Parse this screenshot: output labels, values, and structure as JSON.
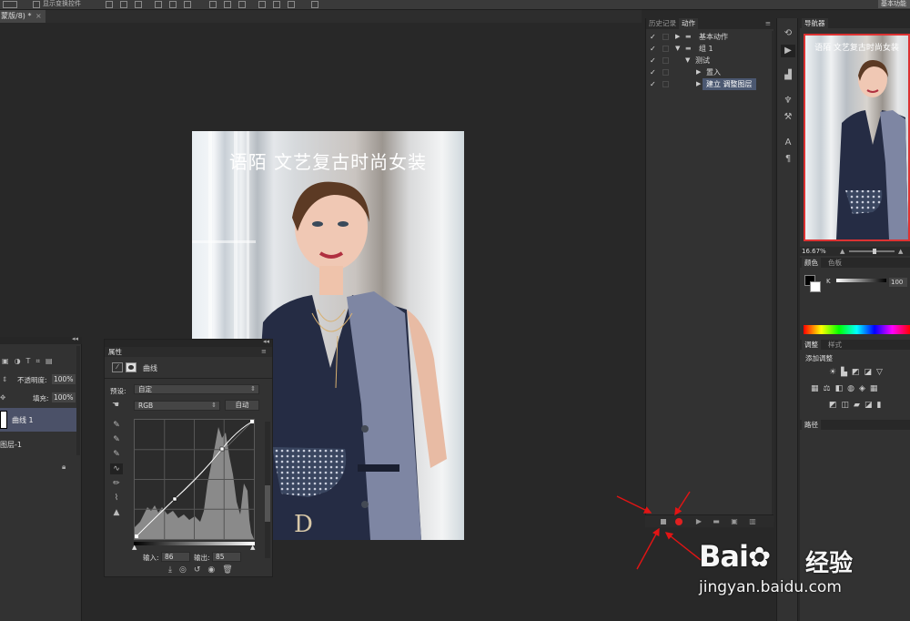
{
  "option_bar": {
    "show_transform_label": "显示变换控件",
    "workspace_label": "基本功能"
  },
  "document_tab": {
    "label": "蒙版/8) *",
    "close": "×"
  },
  "photo": {
    "caption": "语陌  文艺复古时尚女装"
  },
  "actions_panel": {
    "tabs": [
      "历史记录",
      "动作"
    ],
    "active_tab": "动作",
    "rows": [
      {
        "checked": "✓",
        "label": "基本动作",
        "indent": 0,
        "folder": true
      },
      {
        "checked": "✓",
        "label": "组 1",
        "indent": 0,
        "folder": true,
        "expanded": true
      },
      {
        "checked": "✓",
        "label": "测试",
        "indent": 1,
        "expanded": true
      },
      {
        "checked": "✓",
        "label": "置入",
        "indent": 2
      },
      {
        "checked": "✓",
        "label": "建立 调整图层",
        "indent": 2,
        "selected": true
      }
    ],
    "bottom_buttons": [
      "stop",
      "record",
      "play",
      "new-set",
      "new-action",
      "delete"
    ]
  },
  "navigator": {
    "tab": "导航器",
    "caption": "语陌  文艺复古时尚女装",
    "zoom": "16.67%"
  },
  "color_panel": {
    "tabs": [
      "颜色",
      "色板"
    ],
    "channel_label": "K",
    "channel_value": "100"
  },
  "adjustments_panel": {
    "tabs": [
      "调整",
      "样式"
    ],
    "add_label": "添加调整"
  },
  "paths_panel": {
    "tab": "路径"
  },
  "layers_panel": {
    "opacity_label": "不透明度:",
    "opacity_value": "100%",
    "fill_label": "填充:",
    "fill_value": "100%",
    "layers": [
      {
        "name": "曲线 1",
        "selected": true
      },
      {
        "name": "图层-1"
      }
    ]
  },
  "properties_panel": {
    "title": "属性",
    "type_label": "曲线",
    "preset_label": "预设:",
    "preset_value": "自定",
    "channel_value": "RGB",
    "auto_button": "自动",
    "input_label": "输入:",
    "input_value": "86",
    "output_label": "输出:",
    "output_value": "85"
  },
  "watermark": {
    "logo": "Bai",
    "logo_suffix": "经验",
    "url": "jingyan.baidu.com"
  }
}
